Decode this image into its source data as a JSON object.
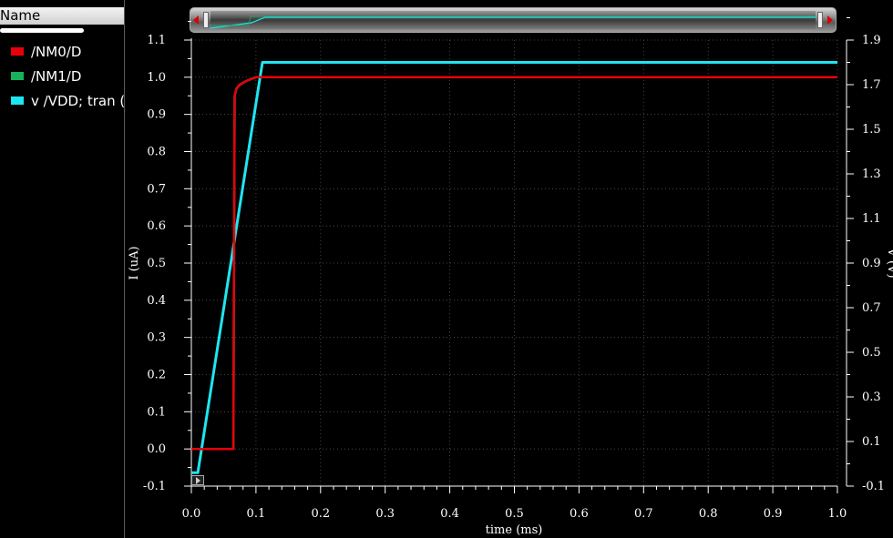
{
  "legend": {
    "header": "Name",
    "items": [
      {
        "label": "/NM0/D",
        "color": "#e8000b"
      },
      {
        "label": "/NM1/D",
        "color": "#17b25a"
      },
      {
        "label": "v /VDD; tran (",
        "color": "#1ee6f0"
      }
    ]
  },
  "chart_data": {
    "type": "line",
    "xlabel": "time (ms)",
    "ylabel": "I (uA)",
    "y2label": "V (V)",
    "xlim": [
      0.0,
      1.0
    ],
    "ylim": [
      -0.1,
      1.1
    ],
    "y2lim": [
      -0.1,
      1.9
    ],
    "x_ticks": [
      "0.0",
      "0.1",
      "0.2",
      "0.3",
      "0.4",
      "0.5",
      "0.6",
      "0.7",
      "0.8",
      "0.9",
      "1.0"
    ],
    "y_ticks": [
      "-0.1",
      "0.0",
      "0.1",
      "0.2",
      "0.3",
      "0.4",
      "0.5",
      "0.6",
      "0.7",
      "0.8",
      "0.9",
      "1.0",
      "1.1"
    ],
    "y2_ticks": [
      "-0.1",
      "0.1",
      "0.3",
      "0.5",
      "0.7",
      "0.9",
      "1.1",
      "1.3",
      "1.5",
      "1.7",
      "1.9"
    ],
    "grid": true,
    "series": [
      {
        "name": "/NM0/D",
        "axis": "left",
        "color": "#e8000b",
        "x": [
          0.0,
          0.065,
          0.066,
          0.067,
          0.07,
          0.075,
          0.085,
          0.1,
          0.12,
          1.0
        ],
        "y": [
          0.0,
          0.0,
          0.5,
          0.95,
          0.97,
          0.98,
          0.99,
          1.0,
          1.0,
          1.0
        ]
      },
      {
        "name": "/NM1/D",
        "axis": "left",
        "color": "#17b25a",
        "x": [
          0.0,
          0.065,
          0.066,
          0.067,
          0.07,
          0.075,
          0.085,
          0.1,
          0.12,
          1.0
        ],
        "y": [
          0.0,
          0.0,
          0.5,
          0.95,
          0.97,
          0.98,
          0.99,
          1.0,
          1.0,
          1.0
        ]
      },
      {
        "name": "v /VDD; tran (",
        "axis": "right",
        "color": "#1ee6f0",
        "x": [
          0.0,
          0.01,
          0.11,
          1.0
        ],
        "y": [
          -0.04,
          -0.04,
          1.8,
          1.8
        ]
      }
    ]
  }
}
